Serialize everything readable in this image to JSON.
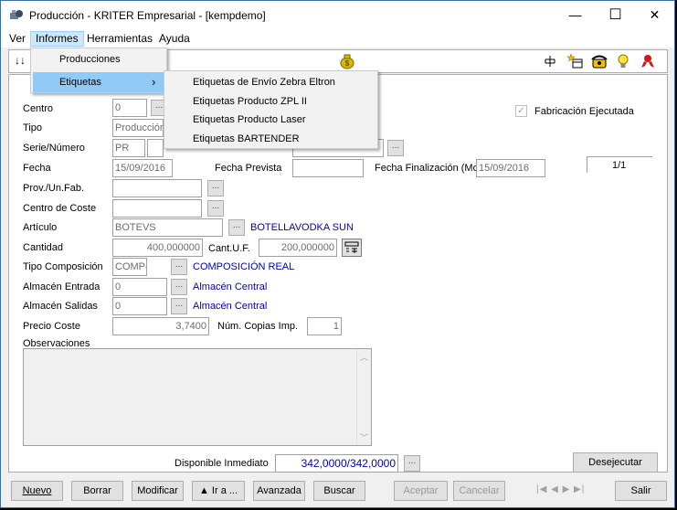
{
  "window": {
    "title": "Producción - KRITER Empresarial  - [kempdemo]",
    "minimize_glyph": "—",
    "maximize_glyph": "☐",
    "close_glyph": "✕"
  },
  "menubar": {
    "items": [
      "Ver",
      "Informes",
      "Herramientas",
      "Ayuda"
    ]
  },
  "informes_menu": {
    "items": [
      "Producciones",
      "Etiquetas"
    ],
    "submenu_arrow": "›"
  },
  "etiquetas_submenu": {
    "items": [
      "Etiquetas de Envío Zebra Eltron",
      "Etiquetas Producto ZPL II",
      "Etiquetas Producto Laser",
      "Etiquetas BARTENDER"
    ]
  },
  "toolbar": {
    "sort_glyph": "↓↓",
    "icons": [
      "money-bag-icon",
      "tree-icon",
      "add-record-icon",
      "phone-icon",
      "lightbulb-icon",
      "ribbon-icon"
    ]
  },
  "form": {
    "centro_label": "Centro",
    "centro_value": "0",
    "tipo_label": "Tipo",
    "tipo_value": "Producción",
    "serie_label": "Serie/Número",
    "serie_value": "PR",
    "fecha_label": "Fecha",
    "fecha_value": "15/09/2016",
    "fecha_prevista_label": "Fecha Prevista",
    "fecha_prevista_value": "",
    "fecha_finalizacion_label": "Fecha Finalización (Mov.",
    "fecha_finalizacion_value": "15/09/2016",
    "page_counter": "1/1",
    "fabricacion_label": "Fabricación Ejecutada",
    "fabricacion_checked": true,
    "prov_label": "Prov./Un.Fab.",
    "prov_value": "",
    "centro_coste_label": "Centro de Coste",
    "centro_coste_value": "",
    "articulo_label": "Artículo",
    "articulo_value": "BOTEVS",
    "articulo_desc": "BOTELLAVODKA SUN",
    "cantidad_label": "Cantidad",
    "cantidad_value": "400,000000",
    "cant_uf_label": "Cant.U.F.",
    "cant_uf_value": "200,000000",
    "tipo_comp_label": "Tipo Composición",
    "tipo_comp_value": "COMP(",
    "tipo_comp_desc": "COMPOSICIÓN REAL",
    "alm_entrada_label": "Almacén Entrada",
    "alm_entrada_value": "0",
    "alm_entrada_desc": "Almacén Central",
    "alm_salidas_label": "Almacén Salidas",
    "alm_salidas_value": "0",
    "alm_salidas_desc": "Almacén Central",
    "precio_coste_label": "Precio Coste",
    "precio_coste_value": "3,7400",
    "num_copias_label": "Núm. Copias Imp.",
    "num_copias_value": "1",
    "observaciones_label": "Observaciones",
    "dots": "..."
  },
  "footer": {
    "disponible_label": "Disponible Inmediato",
    "disponible_value": "342,0000/342,0000",
    "desejecutar_label": "Desejecutar",
    "buttons": {
      "nuevo": "Nuevo",
      "borrar": "Borrar",
      "modificar": "Modificar",
      "ir_a": "▲ Ir a ...",
      "avanzada": "Avanzada",
      "buscar": "Buscar",
      "aceptar": "Aceptar",
      "cancelar": "Cancelar",
      "salir": "Salir"
    },
    "nav_glyphs": [
      "|◀",
      "◀",
      "▶",
      "▶|"
    ]
  }
}
